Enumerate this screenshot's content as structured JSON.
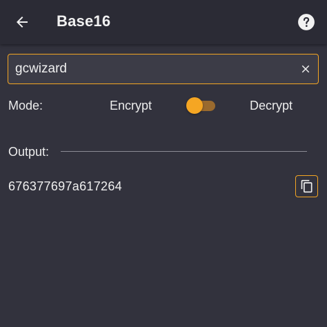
{
  "appbar": {
    "title": "Base16",
    "back_icon": "arrow-left-icon",
    "help_icon": "help-circle-icon"
  },
  "input": {
    "value": "gcwizard",
    "clear_icon": "close-icon"
  },
  "mode": {
    "label": "Mode:",
    "left_option": "Encrypt",
    "right_option": "Decrypt",
    "selected": "Encrypt"
  },
  "output": {
    "label": "Output:",
    "value": "676377697a617264",
    "copy_icon": "copy-icon"
  },
  "colors": {
    "accent": "#f5a623",
    "background": "#32323d",
    "appbar": "#2b2b35"
  }
}
